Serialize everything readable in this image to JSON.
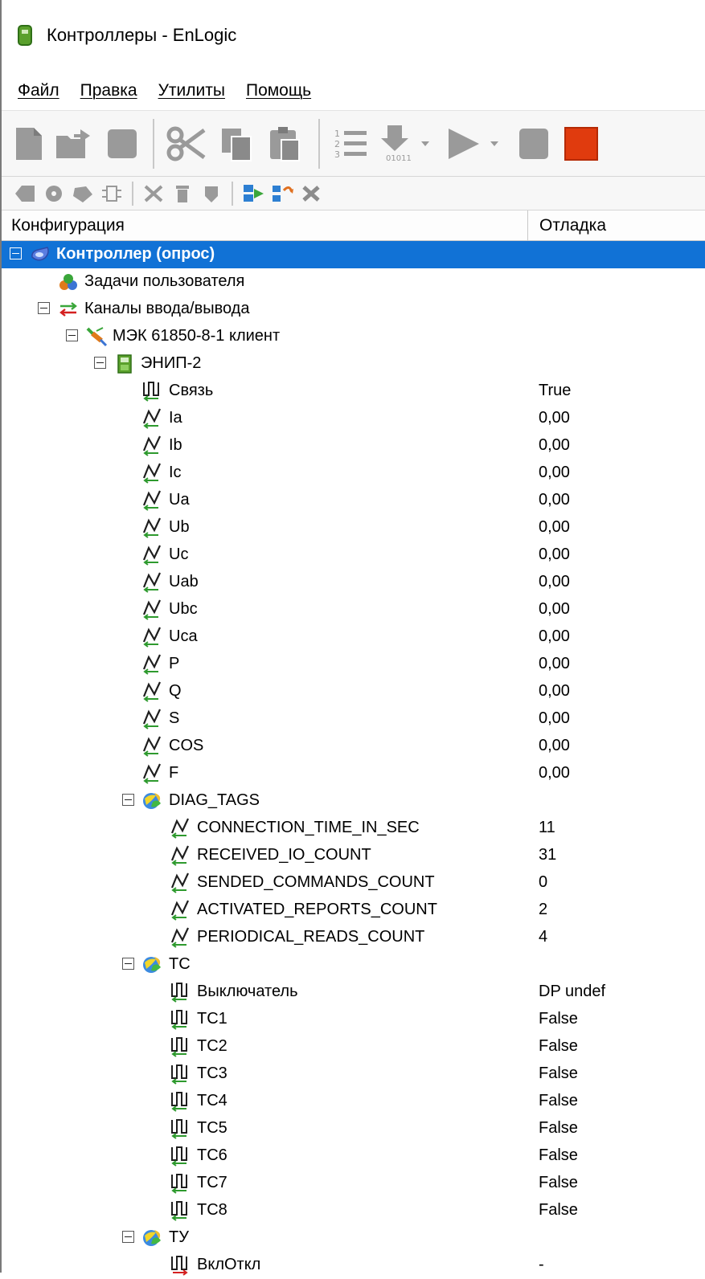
{
  "window": {
    "title": "Контроллеры - EnLogic"
  },
  "menu": [
    "Файл",
    "Правка",
    "Утилиты",
    "Помощь"
  ],
  "columns": {
    "configuration": "Конфигурация",
    "debug": "Отладка"
  },
  "colors": {
    "selection": "#1172d6",
    "stop_button": "#e03b0e",
    "analog_icon": "#1e1e1e",
    "arrow_green": "#2e9a2e",
    "arrow_red": "#d42020"
  },
  "tree": [
    {
      "label": "Контроллер (опрос)",
      "value": "",
      "icon": "controller-icon",
      "expander": true,
      "selected": true
    },
    {
      "label": "Задачи пользователя",
      "value": "",
      "icon": "tasks-icon",
      "expander": false
    },
    {
      "label": "Каналы ввода/вывода",
      "value": "",
      "icon": "io-channels-icon",
      "expander": true
    },
    {
      "label": "МЭК 61850-8-1 клиент",
      "value": "",
      "icon": "iec-client-icon",
      "expander": true
    },
    {
      "label": "ЭНИП-2",
      "value": "",
      "icon": "device-icon",
      "expander": true
    },
    {
      "label": "Связь",
      "value": "True",
      "icon": "discrete-input-icon",
      "expander": false
    },
    {
      "label": "Ia",
      "value": "0,00",
      "icon": "analog-input-icon",
      "expander": false
    },
    {
      "label": "Ib",
      "value": "0,00",
      "icon": "analog-input-icon",
      "expander": false
    },
    {
      "label": "Ic",
      "value": "0,00",
      "icon": "analog-input-icon",
      "expander": false
    },
    {
      "label": "Ua",
      "value": "0,00",
      "icon": "analog-input-icon",
      "expander": false
    },
    {
      "label": "Ub",
      "value": "0,00",
      "icon": "analog-input-icon",
      "expander": false
    },
    {
      "label": "Uc",
      "value": "0,00",
      "icon": "analog-input-icon",
      "expander": false
    },
    {
      "label": "Uab",
      "value": "0,00",
      "icon": "analog-input-icon",
      "expander": false
    },
    {
      "label": "Ubc",
      "value": "0,00",
      "icon": "analog-input-icon",
      "expander": false
    },
    {
      "label": "Uca",
      "value": "0,00",
      "icon": "analog-input-icon",
      "expander": false
    },
    {
      "label": "P",
      "value": "0,00",
      "icon": "analog-input-icon",
      "expander": false
    },
    {
      "label": "Q",
      "value": "0,00",
      "icon": "analog-input-icon",
      "expander": false
    },
    {
      "label": "S",
      "value": "0,00",
      "icon": "analog-input-icon",
      "expander": false
    },
    {
      "label": "COS",
      "value": "0,00",
      "icon": "analog-input-icon",
      "expander": false
    },
    {
      "label": "F",
      "value": "0,00",
      "icon": "analog-input-icon",
      "expander": false
    },
    {
      "label": "DIAG_TAGS",
      "value": "",
      "icon": "group-icon",
      "expander": true
    },
    {
      "label": "CONNECTION_TIME_IN_SEC",
      "value": "11",
      "icon": "analog-input-icon",
      "expander": false
    },
    {
      "label": "RECEIVED_IO_COUNT",
      "value": "31",
      "icon": "analog-input-icon",
      "expander": false
    },
    {
      "label": "SENDED_COMMANDS_COUNT",
      "value": "0",
      "icon": "analog-input-icon",
      "expander": false
    },
    {
      "label": "ACTIVATED_REPORTS_COUNT",
      "value": "2",
      "icon": "analog-input-icon",
      "expander": false
    },
    {
      "label": "PERIODICAL_READS_COUNT",
      "value": "4",
      "icon": "analog-input-icon",
      "expander": false
    },
    {
      "label": "ТС",
      "value": "",
      "icon": "group-icon",
      "expander": true
    },
    {
      "label": "Выключатель",
      "value": "DP undef",
      "icon": "discrete-input-icon",
      "expander": false
    },
    {
      "label": "ТС1",
      "value": "False",
      "icon": "discrete-input-icon",
      "expander": false
    },
    {
      "label": "ТС2",
      "value": "False",
      "icon": "discrete-input-icon",
      "expander": false
    },
    {
      "label": "ТС3",
      "value": "False",
      "icon": "discrete-input-icon",
      "expander": false
    },
    {
      "label": "ТС4",
      "value": "False",
      "icon": "discrete-input-icon",
      "expander": false
    },
    {
      "label": "ТС5",
      "value": "False",
      "icon": "discrete-input-icon",
      "expander": false
    },
    {
      "label": "ТС6",
      "value": "False",
      "icon": "discrete-input-icon",
      "expander": false
    },
    {
      "label": "ТС7",
      "value": "False",
      "icon": "discrete-input-icon",
      "expander": false
    },
    {
      "label": "ТС8",
      "value": "False",
      "icon": "discrete-input-icon",
      "expander": false
    },
    {
      "label": "ТУ",
      "value": "",
      "icon": "group-icon",
      "expander": true
    },
    {
      "label": "ВклОткл",
      "value": "-",
      "icon": "discrete-output-icon",
      "expander": false
    }
  ]
}
